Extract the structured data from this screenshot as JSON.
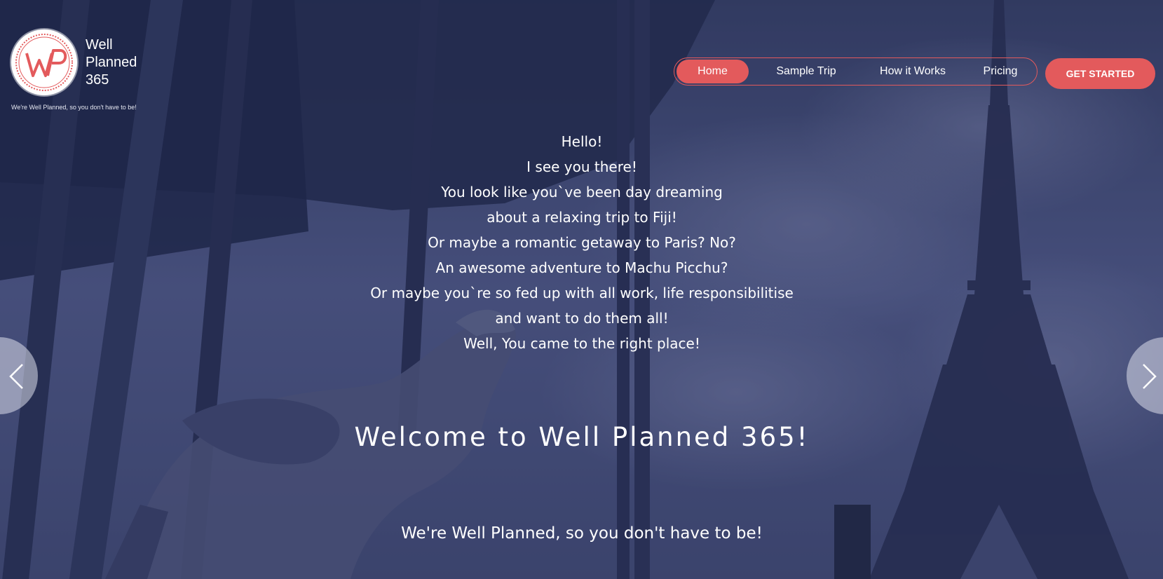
{
  "brand": {
    "logo_mark": "WP",
    "name_line1": "Well",
    "name_line2": "Planned",
    "name_line3": "365",
    "tagline": "We're Well Planned, so you don't have to be!",
    "accent_color": "#e35a5c"
  },
  "nav": {
    "items": [
      {
        "label": "Home",
        "active": true
      },
      {
        "label": "Sample Trip",
        "active": false
      },
      {
        "label": "How it Works",
        "active": false
      },
      {
        "label": "Pricing",
        "active": false
      }
    ],
    "cta_label": "GET STARTED"
  },
  "hero": {
    "intro_lines": [
      "Hello!",
      "I see you there!",
      "You look like you`ve been day dreaming",
      "about a relaxing trip to Fiji!",
      "Or maybe a romantic getaway to Paris? No?",
      "An awesome adventure to Machu Picchu?",
      "Or maybe you`re so fed up with all work, life responsibilitise",
      "and want to do them all!",
      "Well, You came to the right place!"
    ],
    "welcome": "Welcome to Well Planned 365!",
    "subtitle": "We're Well Planned, so you don't have to be!"
  },
  "slider": {
    "prev_icon": "chevron-left-icon",
    "next_icon": "chevron-right-icon"
  }
}
